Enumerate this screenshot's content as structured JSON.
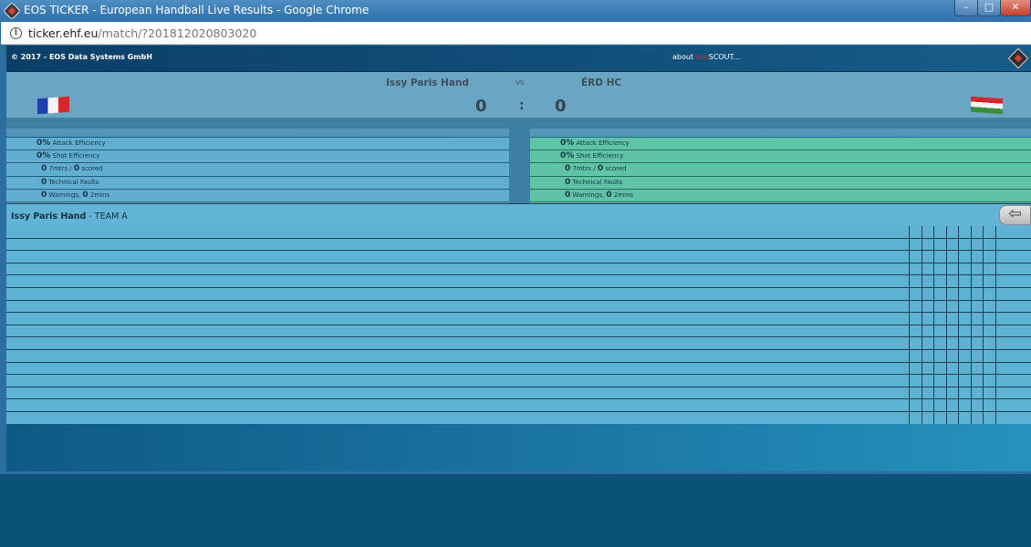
{
  "window": {
    "title": "EOS TICKER - European Handball Live Results - Google Chrome",
    "minimize_label": "–",
    "maximize_label": "□",
    "close_label": "✕"
  },
  "address": {
    "host": "ticker.ehf.eu",
    "path": "/match/?201812020803020"
  },
  "header": {
    "copyright": "© 2017 - EOS Data Systems GmbH",
    "about_prefix": "about",
    "about_brand": "eos",
    "about_suffix": "SCOUT..."
  },
  "match": {
    "home_team": "Issy Paris Hand",
    "away_team": "ÉRD HC",
    "vs": "VS",
    "home_score": "0",
    "score_separator": ":",
    "away_score": "0",
    "home_flag": "france-flag",
    "away_flag": "hungary-flag"
  },
  "stats": {
    "home": [
      {
        "value": "0%",
        "label": "Attack Efficiency"
      },
      {
        "value": "0%",
        "label": "Shot Efficiency"
      },
      {
        "value": "0",
        "label": "7mtrs /",
        "value2": "0",
        "label2": "scored"
      },
      {
        "value": "0",
        "label": "Technical Faults"
      },
      {
        "value": "0",
        "label": "Warnings,",
        "value2": "0",
        "label2": "2mins"
      }
    ],
    "away": [
      {
        "value": "0%",
        "label": "Attack Efficiency"
      },
      {
        "value": "0%",
        "label": "Shot Efficiency"
      },
      {
        "value": "0",
        "label": "7mtrs /",
        "value2": "0",
        "label2": "scored"
      },
      {
        "value": "0",
        "label": "Technical Faults"
      },
      {
        "value": "0",
        "label": "Warnings,",
        "value2": "0",
        "label2": "2mins"
      }
    ]
  },
  "roster": {
    "team_name": "Issy Paris Hand",
    "team_suffix": " - TEAM A",
    "back_icon": "back-arrow-icon",
    "back_label": "⇦"
  },
  "colors": {
    "home_stats": "#61aed0",
    "away_stats": "#5fc3a6",
    "brand_red": "#e0242d"
  }
}
